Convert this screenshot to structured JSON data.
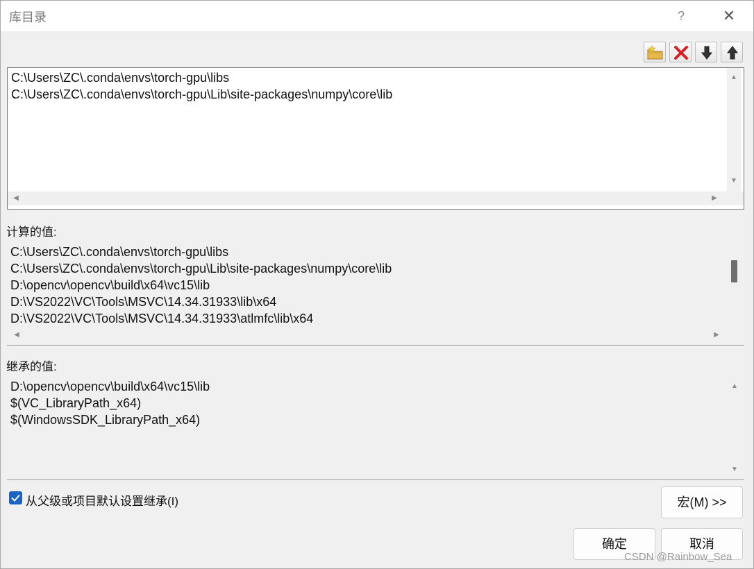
{
  "dialog": {
    "title": "库目录",
    "help_glyph": "?",
    "close_glyph": "✕"
  },
  "toolbar": {
    "buttons": [
      {
        "icon": "new-line-folder-icon"
      },
      {
        "icon": "delete-line-icon"
      },
      {
        "icon": "move-down-icon"
      },
      {
        "icon": "move-up-icon"
      }
    ]
  },
  "edit_list": {
    "lines": [
      "C:\\Users\\ZC\\.conda\\envs\\torch-gpu\\libs",
      "C:\\Users\\ZC\\.conda\\envs\\torch-gpu\\Lib\\site-packages\\numpy\\core\\lib"
    ]
  },
  "evaluated": {
    "label": "计算的值:",
    "lines": [
      "C:\\Users\\ZC\\.conda\\envs\\torch-gpu\\libs",
      "C:\\Users\\ZC\\.conda\\envs\\torch-gpu\\Lib\\site-packages\\numpy\\core\\lib",
      "D:\\opencv\\opencv\\build\\x64\\vc15\\lib",
      "D:\\VS2022\\VC\\Tools\\MSVC\\14.34.31933\\lib\\x64",
      "D:\\VS2022\\VC\\Tools\\MSVC\\14.34.31933\\atlmfc\\lib\\x64"
    ]
  },
  "inherited": {
    "label": "继承的值:",
    "lines": [
      "D:\\opencv\\opencv\\build\\x64\\vc15\\lib",
      "$(VC_LibraryPath_x64)",
      "$(WindowsSDK_LibraryPath_x64)"
    ]
  },
  "inherit_checkbox": {
    "label": "从父级或项目默认设置继承(I)",
    "checked": true
  },
  "buttons": {
    "macros": "宏(M) >>",
    "ok": "确定",
    "cancel": "取消"
  },
  "watermark": "CSDN @Rainbow_Sea",
  "colors": {
    "accent": "#1b64c4",
    "delete_red": "#d42020",
    "folder_yellow": "#e8b84a"
  }
}
